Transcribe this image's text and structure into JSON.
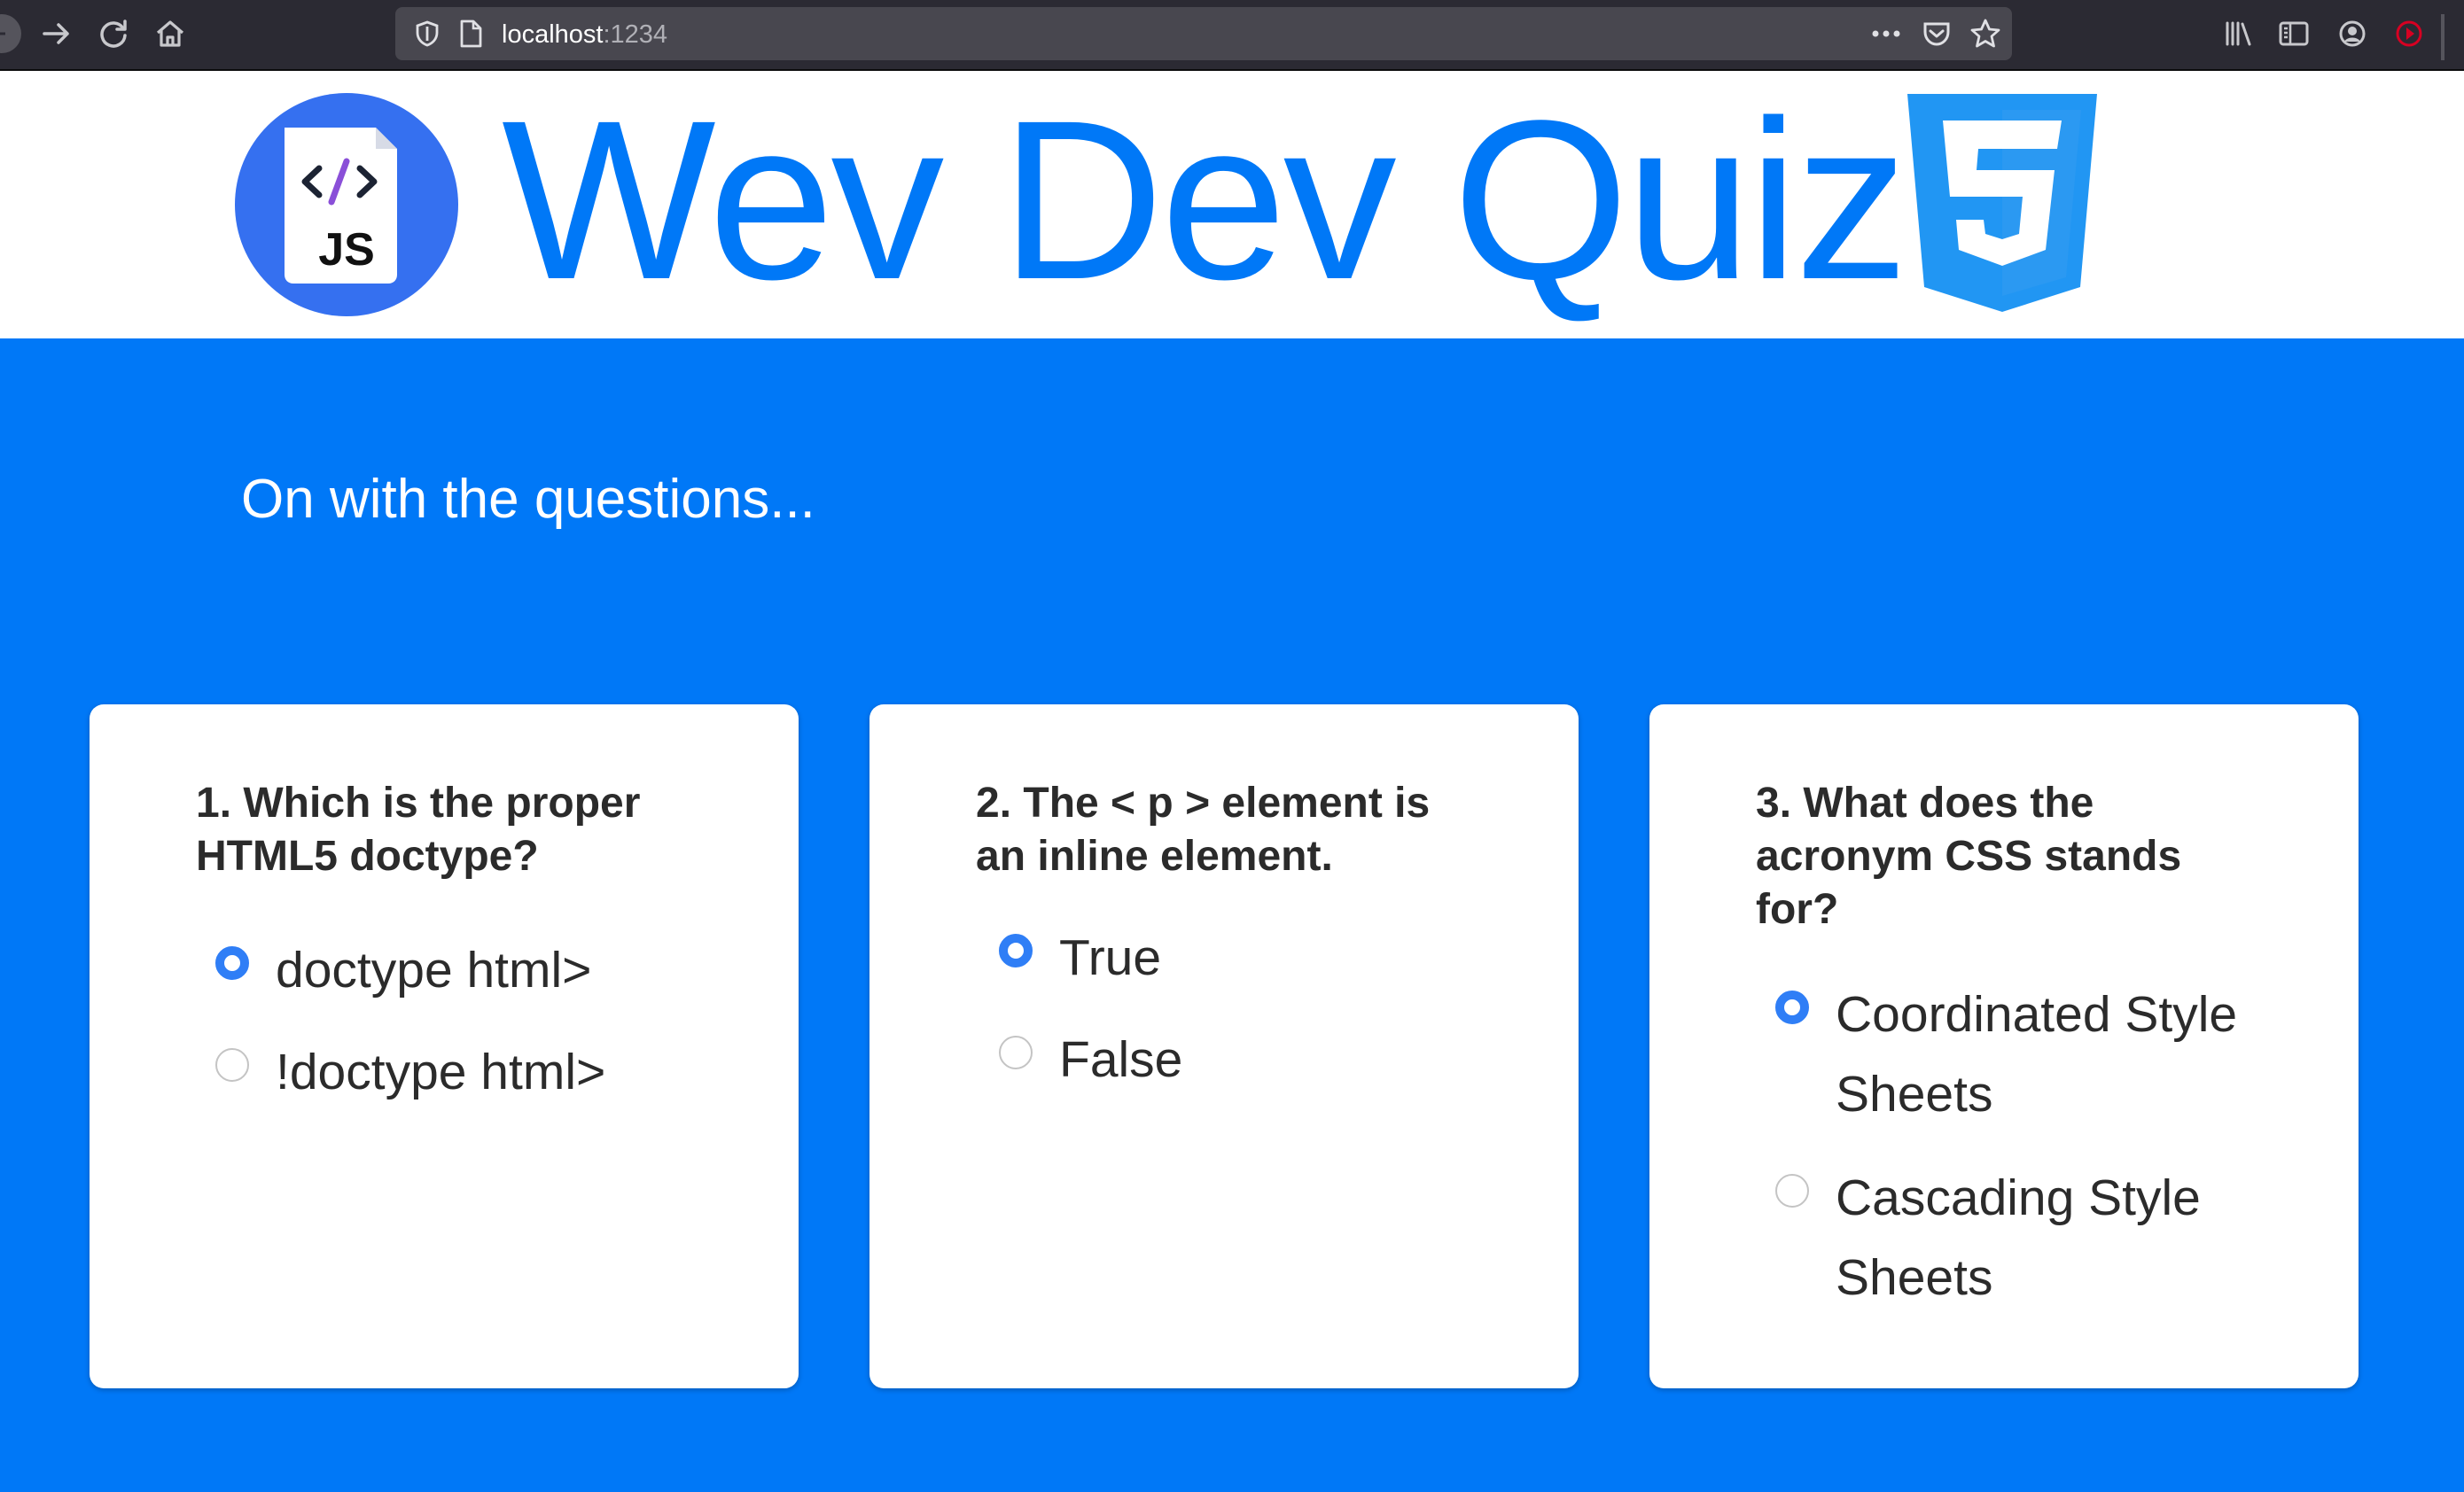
{
  "browser": {
    "url_host": "localhost",
    "url_port": ":1234",
    "icons": [
      "back-icon",
      "forward-icon",
      "reload-icon",
      "home-icon",
      "tracking-shield-icon",
      "page-icon",
      "more-actions-icon",
      "pocket-icon",
      "bookmark-star-icon",
      "library-icon",
      "sidebar-icon",
      "account-icon",
      "extension-icon"
    ]
  },
  "header": {
    "title": "Wev Dev Quiz",
    "js_logo_text": "JS",
    "js_logo_code": "</>"
  },
  "main": {
    "subheading": "On with the questions..."
  },
  "questions": [
    {
      "text": "1. Which is the proper HTML5 doctype?",
      "options": [
        {
          "label": "doctype html>",
          "checked": true
        },
        {
          "label": "!doctype html>",
          "checked": false
        }
      ]
    },
    {
      "text": "2. The < p > element is an inline element.",
      "options": [
        {
          "label": "True",
          "checked": true
        },
        {
          "label": "False",
          "checked": false
        }
      ]
    },
    {
      "text": "3. What does the acronym CSS stands for?",
      "options": [
        {
          "label": "Coordinated Style Sheets",
          "checked": true
        },
        {
          "label": "Cascading Style Sheets",
          "checked": false
        }
      ]
    }
  ],
  "colors": {
    "accent": "#0078f7",
    "radio_checked": "#2f7ef6",
    "text": "#2b2b2b",
    "css_logo": "#2196f3"
  }
}
